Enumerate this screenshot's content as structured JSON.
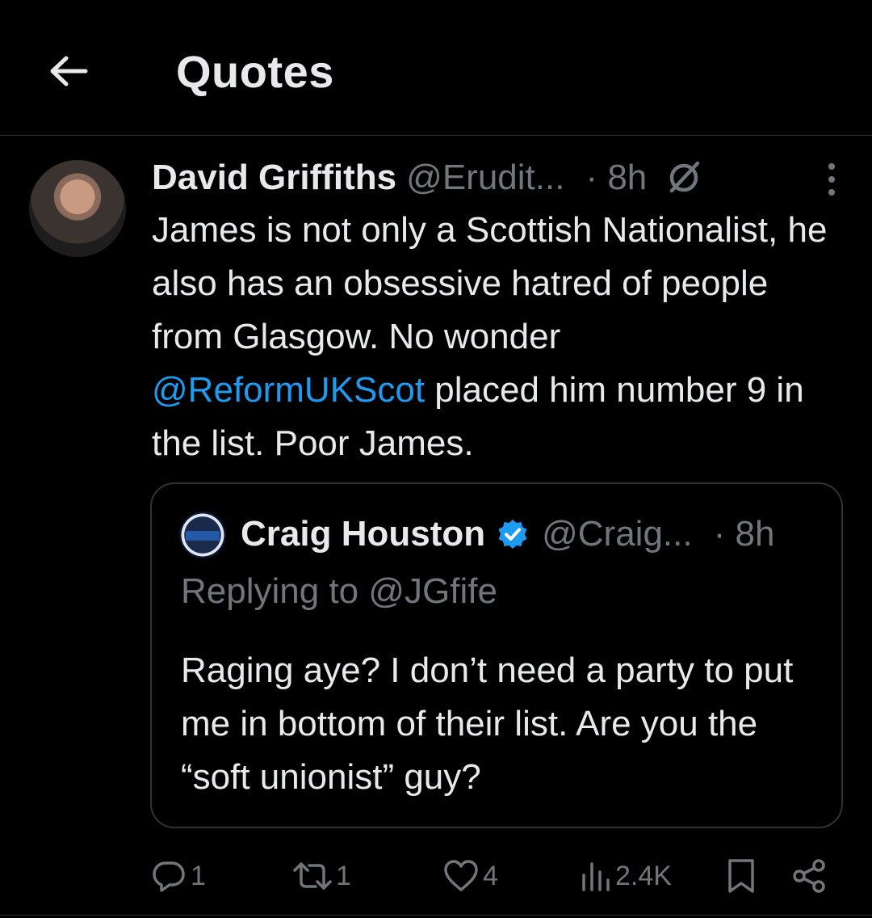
{
  "header": {
    "title": "Quotes"
  },
  "post": {
    "author_name": "David Griffiths",
    "handle": "@Erudit...",
    "time": "· 8h",
    "text_before": "James is not only a Scottish Nationalist, he also has an obsessive hatred of people from Glasgow. No wonder ",
    "mention": "@ReformUKScot",
    "text_after": " placed him number 9 in the list. Poor James."
  },
  "quote": {
    "author_name": "Craig Houston",
    "handle": "@Craig...",
    "time": "· 8h",
    "replying_to": "Replying to @JGfife",
    "text": "Raging aye? I don’t need a party to put me in bottom of their list. Are you the “soft unionist” guy?"
  },
  "actions": {
    "replies": "1",
    "reposts": "1",
    "likes": "4",
    "views": "2.4K"
  },
  "icons": [
    "back-arrow-icon",
    "grok-icon",
    "more-icon",
    "verified-icon",
    "reply-icon",
    "repost-icon",
    "like-icon",
    "views-icon",
    "bookmark-icon",
    "share-icon"
  ],
  "colors": {
    "background": "#000000",
    "text": "#e7e9ea",
    "muted": "#71767b",
    "accent": "#1d9bf0",
    "border": "#2f3336"
  }
}
